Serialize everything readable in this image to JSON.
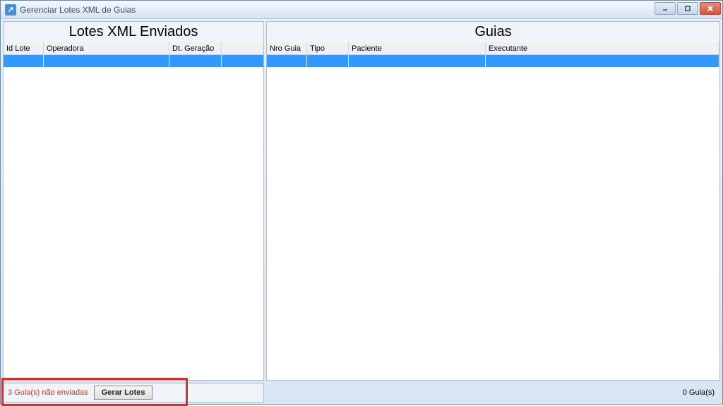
{
  "window": {
    "title": "Gerenciar Lotes XML de Guias",
    "icon_letter": "↗"
  },
  "left_panel": {
    "title": "Lotes XML Enviados",
    "columns": [
      "Id Lote",
      "Operadora",
      "Dt. Geração"
    ],
    "rows": [
      {
        "id_lote": "",
        "operadora": "",
        "dt_geracao": "",
        "selected": true
      }
    ]
  },
  "right_panel": {
    "title": "Guias",
    "columns": [
      "Nro Guia",
      "Tipo",
      "Paciente",
      "Executante"
    ],
    "rows": [
      {
        "nro_guia": "",
        "tipo": "",
        "paciente": "",
        "executante": "",
        "selected": true
      }
    ]
  },
  "status": {
    "unsent_text": "3 Guia(s) não enviadas",
    "gerar_button": "Gerar Lotes",
    "guias_count": "0 Guia(s)"
  }
}
